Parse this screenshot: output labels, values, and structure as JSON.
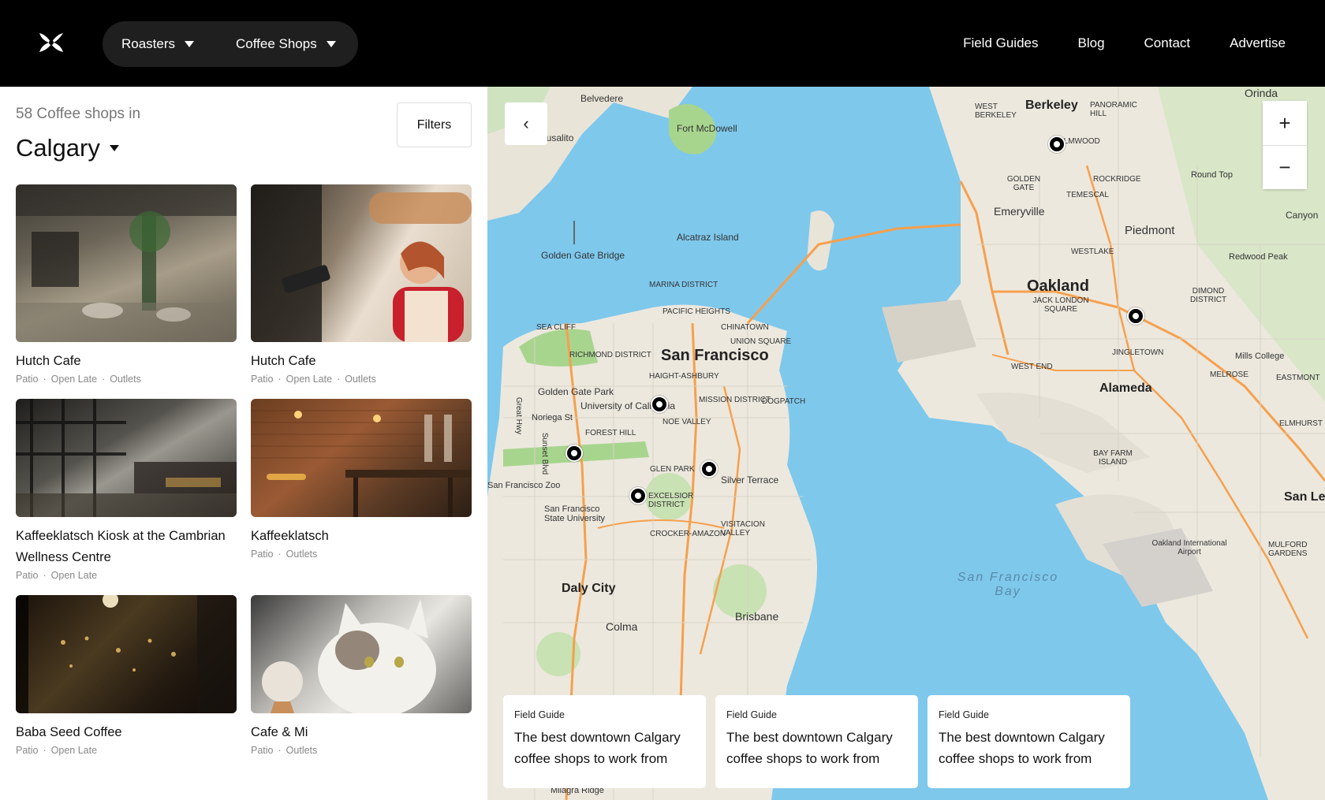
{
  "header": {
    "nav": [
      {
        "label": "Roasters"
      },
      {
        "label": "Coffee Shops"
      }
    ],
    "links": [
      "Field Guides",
      "Blog",
      "Contact",
      "Advertise"
    ]
  },
  "listing": {
    "count_text": "58 Coffee shops in",
    "city": "Calgary",
    "filters_label": "Filters",
    "shops": [
      {
        "name": "Hutch Cafe",
        "tags": [
          "Patio",
          "Open Late",
          "Outlets"
        ]
      },
      {
        "name": "Hutch Cafe",
        "tags": [
          "Patio",
          "Open Late",
          "Outlets"
        ]
      },
      {
        "name": "Kaffeeklatsch Kiosk at the Cambrian Wellness Centre",
        "tags": [
          "Patio",
          "Open Late"
        ]
      },
      {
        "name": "Kaffeeklatsch",
        "tags": [
          "Patio",
          "Outlets"
        ]
      },
      {
        "name": "Baba Seed Coffee",
        "tags": [
          "Patio",
          "Open Late"
        ]
      },
      {
        "name": "Cafe & Mi",
        "tags": [
          "Patio",
          "Outlets"
        ]
      }
    ]
  },
  "map": {
    "labels": {
      "berkeley": "Berkeley",
      "oakland": "Oakland",
      "san_francisco": "San Francisco",
      "alameda": "Alameda",
      "daly_city": "Daly City",
      "emeryville": "Emeryville",
      "piedmont": "Piedmont",
      "belvedere": "Belvedere",
      "sausalito": "Sausalito",
      "fort_mcdowell": "Fort McDowell",
      "alcatraz": "Alcatraz Island",
      "golden_gate_bridge": "Golden Gate Bridge",
      "golden_gate_park": "Golden Gate Park",
      "brisbane": "Brisbane",
      "colma": "Colma",
      "san_francisco_bay": "San Francisco Bay",
      "silver_terrace": "Silver Terrace",
      "canyon": "Canyon",
      "mills_college": "Mills College",
      "san_le": "San Le",
      "oakland_airport": "Oakland International Airport",
      "round_top": "Round Top",
      "redwood_peak": "Redwood Peak",
      "mission": "MISSION DISTRICT",
      "richmond": "RICHMOND DISTRICT",
      "glen_park": "GLEN PARK",
      "forest_hill": "FOREST HILL",
      "noe_valley": "NOE VALLEY",
      "excelsior": "EXCELSIOR DISTRICT",
      "sf_zoo": "San Francisco Zoo",
      "sfsu": "San Francisco State University",
      "ucsf": "University of California",
      "elmhurst": "ELMHURST",
      "melrose": "MELROSE",
      "east_mont": "EASTMONT",
      "jack_london": "JACK LONDON SQUARE",
      "west_end": "WEST END",
      "bay_farm": "BAY FARM ISLAND",
      "mulford": "MULFORD GARDENS",
      "milagra": "Milagra Ridge",
      "urinda": "Orinda",
      "chinatown": "CHINATOWN",
      "union_square": "UNION SQUARE",
      "marina": "MARINA DISTRICT",
      "pacific_heights": "PACIFIC HEIGHTS",
      "haight": "HAIGHT-ASHBURY",
      "dogpatch": "DOGPATCH",
      "crocker": "CROCKER-AMAZON",
      "visitacion": "VISITACION VALLEY",
      "sea_cliff": "SEA CLIFF",
      "noriega": "Noriega St",
      "great_hwy": "Great Hwy",
      "sunset_blvd": "Sunset Blvd",
      "golden_gate": "GOLDEN GATE",
      "rockridge": "ROCKRIDGE",
      "temescal": "TEMESCAL",
      "elmwood": "ELMWOOD",
      "westlake": "WESTLAKE",
      "dimond": "DIMOND DISTRICT",
      "jingletown": "JINGLETOWN",
      "west_berkeley": "WEST BERKELEY",
      "panoramic": "PANORAMIC HILL"
    },
    "zoom_in": "+",
    "zoom_out": "−",
    "back": "‹"
  },
  "guides": [
    {
      "label": "Field Guide",
      "title": "The best downtown Calgary coffee shops to work from"
    },
    {
      "label": "Field Guide",
      "title": "The best downtown Calgary coffee shops to work from"
    },
    {
      "label": "Field Guide",
      "title": "The best downtown Calgary coffee shops to work from"
    }
  ]
}
